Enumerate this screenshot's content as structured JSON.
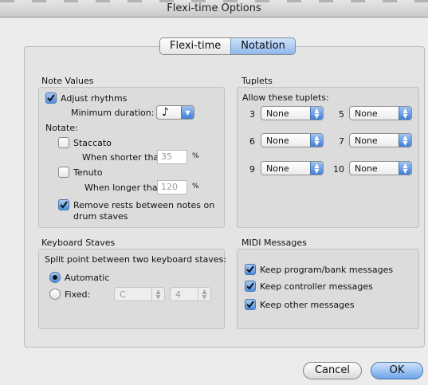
{
  "window": {
    "title": "Flexi-time Options"
  },
  "tabs": [
    {
      "label": "Flexi-time",
      "selected": false
    },
    {
      "label": "Notation",
      "selected": true
    }
  ],
  "note_values": {
    "title": "Note Values",
    "adjust_rhythms": {
      "label": "Adjust rhythms",
      "checked": true
    },
    "minimum_duration": {
      "label": "Minimum duration:",
      "value": "♪"
    },
    "notate_label": "Notate:",
    "staccato": {
      "label": "Staccato",
      "checked": false,
      "threshold_label": "When shorter than:",
      "value": "35",
      "unit": "%"
    },
    "tenuto": {
      "label": "Tenuto",
      "checked": false,
      "threshold_label": "When longer than:",
      "value": "120",
      "unit": "%"
    },
    "remove_rests": {
      "label_line1": "Remove rests between notes on",
      "label_line2": "drum staves",
      "checked": true
    }
  },
  "tuplets": {
    "title": "Tuplets",
    "allow_label": "Allow these tuplets:",
    "items": [
      {
        "number": "3",
        "value": "None"
      },
      {
        "number": "5",
        "value": "None"
      },
      {
        "number": "6",
        "value": "None"
      },
      {
        "number": "7",
        "value": "None"
      },
      {
        "number": "9",
        "value": "None"
      },
      {
        "number": "10",
        "value": "None"
      }
    ]
  },
  "keyboard_staves": {
    "title": "Keyboard Staves",
    "split_label": "Split point between two keyboard staves:",
    "automatic": {
      "label": "Automatic",
      "selected": true
    },
    "fixed": {
      "label": "Fixed:",
      "selected": false,
      "note": "C",
      "octave": "4"
    }
  },
  "midi": {
    "title": "MIDI Messages",
    "items": [
      {
        "label": "Keep program/bank messages",
        "checked": true
      },
      {
        "label": "Keep controller messages",
        "checked": true
      },
      {
        "label": "Keep other messages",
        "checked": true
      }
    ]
  },
  "buttons": {
    "cancel": "Cancel",
    "ok": "OK"
  },
  "colors": {
    "accent": "#4f8fe0",
    "panel": "#e4e4e4"
  }
}
